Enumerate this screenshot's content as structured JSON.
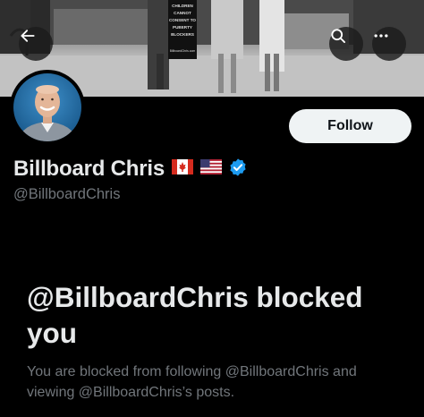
{
  "banner": {
    "sign_text": [
      "CHILDREN",
      "CANNOT",
      "CONSENT TO",
      "PUBERTY",
      "BLOCKERS",
      "BillboardChris.com"
    ]
  },
  "nav": {
    "back_icon": "arrow-left-icon",
    "search_icon": "search-icon",
    "more_icon": "more-horizontal-icon"
  },
  "profile": {
    "display_name": "Billboard Chris",
    "handle": "@BillboardChris",
    "follow_label": "Follow",
    "badges": [
      "canada-flag-icon",
      "usa-flag-icon",
      "verified-badge-icon"
    ]
  },
  "blocked": {
    "title": "@BillboardChris blocked you",
    "description": "You are blocked from following @BillboardChris and viewing @BillboardChris’s posts."
  },
  "colors": {
    "background": "#000000",
    "primary_text": "#e7e9ea",
    "secondary_text": "#71767b",
    "follow_bg": "#eff3f4",
    "verified_blue": "#1d9bf0"
  }
}
